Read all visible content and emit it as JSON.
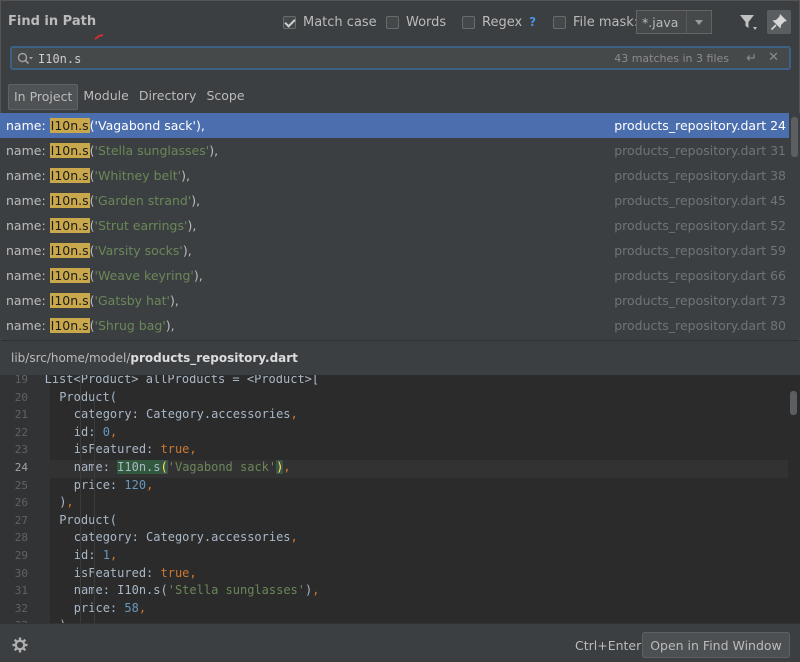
{
  "header": {
    "title": "Find in Path",
    "options": [
      {
        "label": "Match case",
        "checked": true
      },
      {
        "label": "Words",
        "checked": false
      },
      {
        "label": "Regex",
        "checked": false
      },
      {
        "label": "File mask:",
        "checked": false
      }
    ],
    "regex_help": "?",
    "file_mask_value": "*.java"
  },
  "search": {
    "query": "I10n.s",
    "matches": "43 matches in 3 files"
  },
  "scopes": [
    "In Project",
    "Module",
    "Directory",
    "Scope"
  ],
  "active_scope": "In Project",
  "results": [
    {
      "prefix": "name: ",
      "match": "I10n.s",
      "arg": "'Vagabond sack'",
      "suffix": "),",
      "file": "products_repository.dart",
      "line": "24",
      "selected": true
    },
    {
      "prefix": "name: ",
      "match": "I10n.s",
      "arg": "'Stella sunglasses'",
      "suffix": "),",
      "file": "products_repository.dart",
      "line": "31"
    },
    {
      "prefix": "name: ",
      "match": "I10n.s",
      "arg": "'Whitney belt'",
      "suffix": "),",
      "file": "products_repository.dart",
      "line": "38"
    },
    {
      "prefix": "name: ",
      "match": "I10n.s",
      "arg": "'Garden strand'",
      "suffix": "),",
      "file": "products_repository.dart",
      "line": "45"
    },
    {
      "prefix": "name: ",
      "match": "I10n.s",
      "arg": "'Strut earrings'",
      "suffix": "),",
      "file": "products_repository.dart",
      "line": "52"
    },
    {
      "prefix": "name: ",
      "match": "I10n.s",
      "arg": "'Varsity socks'",
      "suffix": "),",
      "file": "products_repository.dart",
      "line": "59"
    },
    {
      "prefix": "name: ",
      "match": "I10n.s",
      "arg": "'Weave keyring'",
      "suffix": "),",
      "file": "products_repository.dart",
      "line": "66"
    },
    {
      "prefix": "name: ",
      "match": "I10n.s",
      "arg": "'Gatsby hat'",
      "suffix": "),",
      "file": "products_repository.dart",
      "line": "73"
    },
    {
      "prefix": "name: ",
      "match": "I10n.s",
      "arg": "'Shrug bag'",
      "suffix": "),",
      "file": "products_repository.dart",
      "line": "80"
    }
  ],
  "preview": {
    "path_dir": "lib/src/home/model/",
    "path_file": "products_repository.dart",
    "current_line": "24",
    "lines": [
      {
        "n": "19",
        "indent": 1,
        "parts": [
          {
            "t": "List<Product> allProducts = <Product>[",
            "c": "cm"
          }
        ]
      },
      {
        "n": "20",
        "indent": 2,
        "parts": [
          {
            "t": "Product(",
            "c": "cm"
          }
        ]
      },
      {
        "n": "21",
        "indent": 3,
        "parts": [
          {
            "t": "category: Category.accessories",
            "c": "cm"
          },
          {
            "t": ",",
            "c": "kw"
          }
        ]
      },
      {
        "n": "22",
        "indent": 3,
        "parts": [
          {
            "t": "id: ",
            "c": "cm"
          },
          {
            "t": "0",
            "c": "num"
          },
          {
            "t": ",",
            "c": "kw"
          }
        ]
      },
      {
        "n": "23",
        "indent": 3,
        "parts": [
          {
            "t": "isFeatured: ",
            "c": "cm"
          },
          {
            "t": "true",
            "c": "kw"
          },
          {
            "t": ",",
            "c": "kw"
          }
        ]
      },
      {
        "n": "24",
        "indent": 3,
        "parts": [
          {
            "t": "name: ",
            "c": "cm"
          },
          {
            "t": "I10n.s",
            "c": "mhl"
          },
          {
            "t": "(",
            "c": "br"
          },
          {
            "t": "'Vagabond sack'",
            "c": "cstr"
          },
          {
            "t": ")",
            "c": "br"
          },
          {
            "t": ",",
            "c": "kw"
          }
        ]
      },
      {
        "n": "25",
        "indent": 3,
        "parts": [
          {
            "t": "price: ",
            "c": "cm"
          },
          {
            "t": "120",
            "c": "num"
          },
          {
            "t": ",",
            "c": "kw"
          }
        ]
      },
      {
        "n": "26",
        "indent": 2,
        "parts": [
          {
            "t": ")",
            "c": "cm"
          },
          {
            "t": ",",
            "c": "kw"
          }
        ]
      },
      {
        "n": "27",
        "indent": 2,
        "parts": [
          {
            "t": "Product(",
            "c": "cm"
          }
        ]
      },
      {
        "n": "28",
        "indent": 3,
        "parts": [
          {
            "t": "category: Category.accessories",
            "c": "cm"
          },
          {
            "t": ",",
            "c": "kw"
          }
        ]
      },
      {
        "n": "29",
        "indent": 3,
        "parts": [
          {
            "t": "id: ",
            "c": "cm"
          },
          {
            "t": "1",
            "c": "num"
          },
          {
            "t": ",",
            "c": "kw"
          }
        ]
      },
      {
        "n": "30",
        "indent": 3,
        "parts": [
          {
            "t": "isFeatured: ",
            "c": "cm"
          },
          {
            "t": "true",
            "c": "kw"
          },
          {
            "t": ",",
            "c": "kw"
          }
        ]
      },
      {
        "n": "31",
        "indent": 3,
        "parts": [
          {
            "t": "name: I10n.s(",
            "c": "cm"
          },
          {
            "t": "'Stella sunglasses'",
            "c": "cstr"
          },
          {
            "t": ")",
            "c": "cm"
          },
          {
            "t": ",",
            "c": "kw"
          }
        ]
      },
      {
        "n": "32",
        "indent": 3,
        "parts": [
          {
            "t": "price: ",
            "c": "cm"
          },
          {
            "t": "58",
            "c": "num"
          },
          {
            "t": ",",
            "c": "kw"
          }
        ]
      },
      {
        "n": "33",
        "indent": 2,
        "parts": [
          {
            "t": ")",
            "c": "cm"
          },
          {
            "t": ",",
            "c": "kw"
          }
        ]
      }
    ]
  },
  "footer": {
    "shortcut": "Ctrl+Enter",
    "open_button": "Open in Find Window"
  },
  "colors": {
    "selection": "#4b6eaf",
    "match_highlight": "#c9a84b",
    "string": "#6a8759",
    "keyword": "#cc7832",
    "number": "#6897bb"
  },
  "icons": [
    "search-icon",
    "filter-icon",
    "pin-icon",
    "enter-icon",
    "close-icon",
    "gear-icon"
  ]
}
